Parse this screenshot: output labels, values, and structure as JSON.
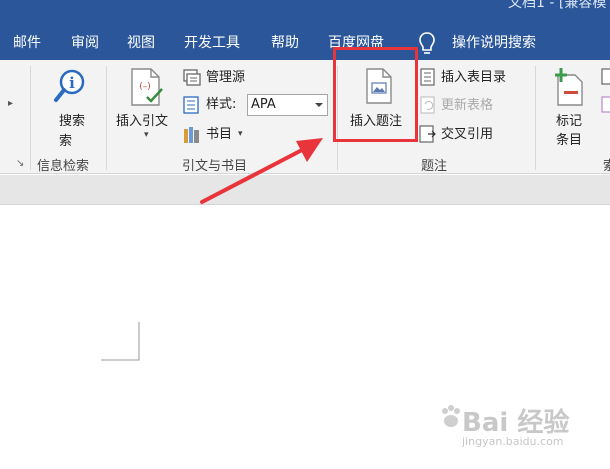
{
  "window": {
    "title": "文档1 - [兼容模"
  },
  "menu": {
    "tabs": [
      "邮件",
      "审阅",
      "视图",
      "开发工具",
      "帮助",
      "百度网盘"
    ],
    "tell_me": "操作说明搜索"
  },
  "ribbon": {
    "search_group": {
      "button": "搜索",
      "label": "信息检索"
    },
    "citations_group": {
      "insert_citation": "插入引文",
      "manage_sources": "管理源",
      "style_label": "样式:",
      "style_value": "APA",
      "bibliography": "书目",
      "label": "引文与书目"
    },
    "captions_group": {
      "insert_caption": "插入题注",
      "insert_table_of_figures": "插入表目录",
      "update_table": "更新表格",
      "cross_reference": "交叉引用",
      "label": "题注"
    },
    "index_group": {
      "mark_entry": "标记\n条目",
      "label": "索"
    }
  },
  "watermark": {
    "main": "Bai 经验",
    "sub": "jingyan.baidu.com"
  },
  "colors": {
    "titlebar": "#2b579a",
    "highlight": "#e8343a",
    "ribbon": "#f3f3f3"
  }
}
